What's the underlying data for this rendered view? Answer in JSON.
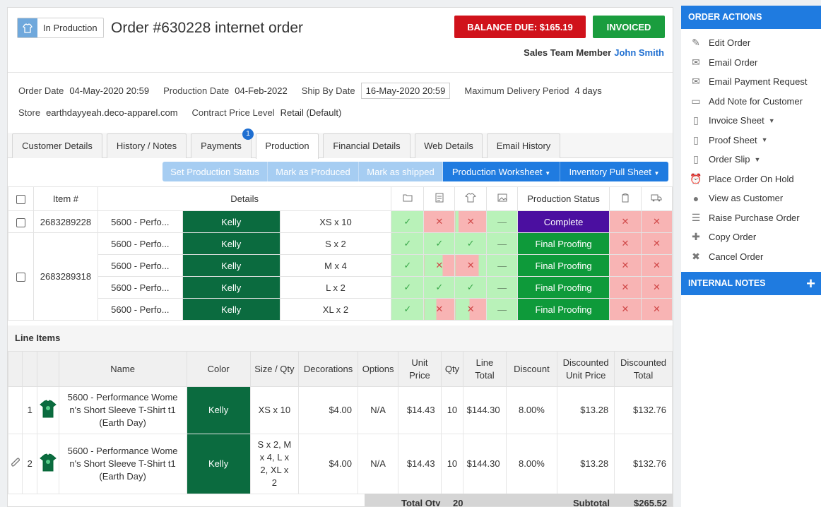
{
  "order": {
    "status": "In Production",
    "title": "Order #630228 internet order",
    "balance_due": "BALANCE DUE: $165.19",
    "invoiced": "INVOICED",
    "sales_label": "Sales Team Member",
    "sales_name": "John Smith"
  },
  "meta": {
    "order_date_label": "Order Date",
    "order_date": "04-May-2020 20:59",
    "production_date_label": "Production Date",
    "production_date": "04-Feb-2022",
    "ship_by_label": "Ship By Date",
    "ship_by": "16-May-2020 20:59",
    "max_delivery_label": "Maximum Delivery Period",
    "max_delivery": "4 days",
    "store_label": "Store",
    "store": "earthdayyeah.deco-apparel.com",
    "contract_label": "Contract Price Level",
    "contract": "Retail (Default)"
  },
  "tabs": [
    {
      "label": "Customer Details"
    },
    {
      "label": "History / Notes"
    },
    {
      "label": "Payments",
      "badge": "1"
    },
    {
      "label": "Production"
    },
    {
      "label": "Financial Details"
    },
    {
      "label": "Web Details"
    },
    {
      "label": "Email History"
    }
  ],
  "actions": {
    "set_status": "Set Production Status",
    "mark_produced": "Mark as Produced",
    "mark_shipped": "Mark as shipped",
    "worksheet": "Production Worksheet",
    "pull_sheet": "Inventory Pull Sheet"
  },
  "production": {
    "headers": {
      "item": "Item #",
      "details": "Details",
      "status": "Production Status"
    },
    "rows": [
      {
        "item": "2683289228",
        "product": "5600 - Perfo...",
        "color": "Kelly",
        "size": "XS x 10",
        "status": "Complete"
      },
      {
        "item": "2683289318",
        "product": "5600 - Perfo...",
        "color": "Kelly",
        "size": "S x 2",
        "status": "Final Proofing"
      },
      {
        "item": "",
        "product": "5600 - Perfo...",
        "color": "Kelly",
        "size": "M x 4",
        "status": "Final Proofing"
      },
      {
        "item": "",
        "product": "5600 - Perfo...",
        "color": "Kelly",
        "size": "L x 2",
        "status": "Final Proofing"
      },
      {
        "item": "",
        "product": "5600 - Perfo...",
        "color": "Kelly",
        "size": "XL x 2",
        "status": "Final Proofing"
      }
    ]
  },
  "line_items": {
    "title": "Line Items",
    "headers": {
      "name": "Name",
      "color": "Color",
      "size_qty": "Size / Qty",
      "decorations": "Decorations",
      "options": "Options",
      "unit_price_1": "Unit",
      "unit_price_2": "Price",
      "qty": "Qty",
      "line_total_1": "Line",
      "line_total_2": "Total",
      "discount": "Discount",
      "disc_unit_1": "Discounted",
      "disc_unit_2": "Unit Price",
      "disc_total_1": "Discounted",
      "disc_total_2": "Total"
    },
    "rows": [
      {
        "num": "1",
        "name": "5600 - Performance Wome\nn's Short Sleeve T-Shirt t1\n(Earth Day)",
        "color": "Kelly",
        "size_qty": "XS x 10",
        "decorations": "$4.00",
        "options": "N/A",
        "unit_price": "$14.43",
        "qty": "10",
        "line_total": "$144.30",
        "discount": "8.00%",
        "disc_unit": "$13.28",
        "disc_total": "$132.76"
      },
      {
        "num": "2",
        "name": "5600 - Performance Wome\nn's Short Sleeve T-Shirt t1\n(Earth Day)",
        "color": "Kelly",
        "size_qty": "S x 2, M\nx 4, L x\n2, XL x\n2",
        "decorations": "$4.00",
        "options": "N/A",
        "unit_price": "$14.43",
        "qty": "10",
        "line_total": "$144.30",
        "discount": "8.00%",
        "disc_unit": "$13.28",
        "disc_total": "$132.76"
      }
    ],
    "totals": {
      "total_qty_label": "Total Qty",
      "total_qty": "20",
      "subtotal_label": "Subtotal",
      "subtotal": "$265.52"
    }
  },
  "sidebar": {
    "order_actions_title": "ORDER ACTIONS",
    "items": [
      {
        "label": "Edit Order"
      },
      {
        "label": "Email Order"
      },
      {
        "label": "Email Payment Request"
      },
      {
        "label": "Add Note for Customer"
      },
      {
        "label": "Invoice Sheet"
      },
      {
        "label": "Proof Sheet"
      },
      {
        "label": "Order Slip"
      },
      {
        "label": "Place Order On Hold"
      },
      {
        "label": "View as Customer"
      },
      {
        "label": "Raise Purchase Order"
      },
      {
        "label": "Copy Order"
      },
      {
        "label": "Cancel Order"
      }
    ],
    "internal_notes_title": "INTERNAL NOTES"
  },
  "colors": {
    "accent": "#1f7be0",
    "balance": "#d0121b",
    "invoiced": "#1a9d3e",
    "kelly": "#0b6b3f",
    "complete": "#4b0fa0",
    "final_proofing": "#0e9a3a"
  }
}
